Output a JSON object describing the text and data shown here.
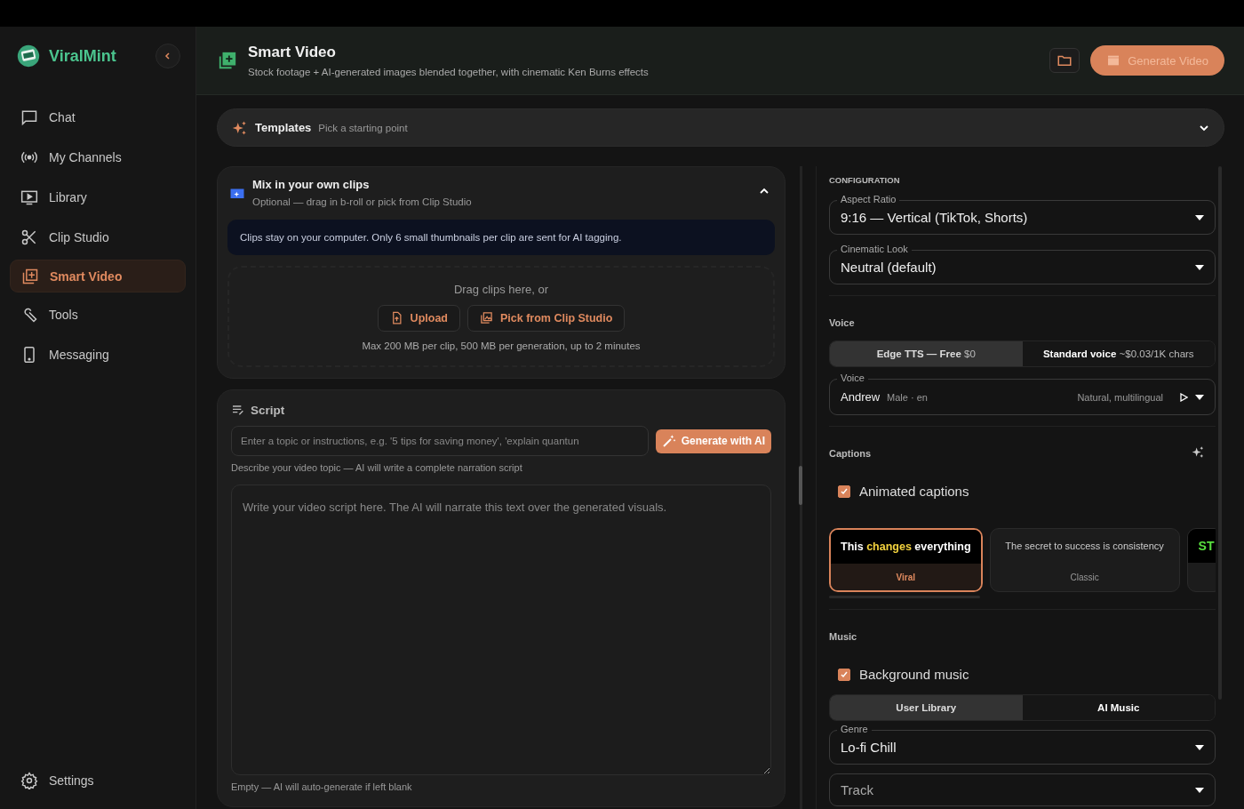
{
  "sidebar": {
    "brand": "ViralMint",
    "items": [
      {
        "label": "Chat",
        "selected": false
      },
      {
        "label": "My Channels",
        "selected": false
      },
      {
        "label": "Library",
        "selected": false
      },
      {
        "label": "Clip Studio",
        "selected": false
      },
      {
        "label": "Smart Video",
        "selected": true
      },
      {
        "label": "Tools",
        "selected": false
      },
      {
        "label": "Messaging",
        "selected": false
      }
    ],
    "settings": "Settings"
  },
  "header": {
    "title": "Smart Video",
    "subtitle": "Stock footage + AI-generated images blended together, with cinematic Ken Burns effects",
    "generate_button": "Generate Video"
  },
  "templates": {
    "title": "Templates",
    "hint": "Pick a starting point",
    "expanded": false
  },
  "clips_panel": {
    "title": "Mix in your own clips",
    "subtitle": "Optional — drag in b-roll or pick from Clip Studio",
    "expanded": true,
    "notice": "Clips stay on your computer. Only 6 small thumbnails per clip are sent for AI tagging.",
    "drop_text": "Drag clips here, or",
    "buttons": [
      {
        "label": "Upload"
      },
      {
        "label": "Pick from Clip Studio"
      }
    ],
    "limits": "Max 200 MB per clip, 500 MB per generation, up to 2 minutes"
  },
  "script_panel": {
    "title": "Script",
    "topic": {
      "placeholder": "Enter a topic or instructions, e.g. '5 tips for saving money', 'explain quantun"
    },
    "generate_button": "Generate with AI",
    "topic_hint": "Describe your video topic — AI will write a complete narration script",
    "script": {
      "placeholder": "Write your video script here. The AI will narrate this text over the generated visuals."
    },
    "script_hint": "Empty — AI will auto-generate if left blank"
  },
  "configuration": {
    "heading": "CONFIGURATION",
    "aspect_ratio": {
      "label": "Aspect Ratio",
      "value": "9:16 — Vertical (TikTok, Shorts)"
    },
    "cinematic_look": {
      "label": "Cinematic Look",
      "value": "Neutral (default)"
    },
    "voice": {
      "heading": "Voice",
      "engines": [
        {
          "label": "Edge TTS — Free",
          "price": "$0",
          "selected": true
        },
        {
          "label": "Standard voice",
          "price": "~$0.03/1K chars",
          "selected": false
        }
      ],
      "select": {
        "label": "Voice",
        "name": "Andrew",
        "meta": "Male · en",
        "style": "Natural, multilingual"
      }
    },
    "captions": {
      "heading": "Captions",
      "animated": {
        "label": "Animated captions",
        "checked": true
      },
      "styles": [
        {
          "before": "This ",
          "highlight": "changes",
          "after": " everything",
          "name": "Viral",
          "selected": true,
          "kind": "viral"
        },
        {
          "before": "The secret to success is consistency",
          "name": "Classic",
          "selected": false,
          "kind": "classic"
        },
        {
          "highlight": "ST",
          "selected": false,
          "kind": "bold"
        }
      ]
    },
    "music": {
      "heading": "Music",
      "background": {
        "label": "Background music",
        "checked": true
      },
      "sources": [
        {
          "label": "User Library",
          "selected": true
        },
        {
          "label": "AI Music",
          "selected": false
        }
      ],
      "genre": {
        "label": "Genre",
        "value": "Lo-fi Chill"
      },
      "track": {
        "placeholder": "Track"
      }
    }
  }
}
